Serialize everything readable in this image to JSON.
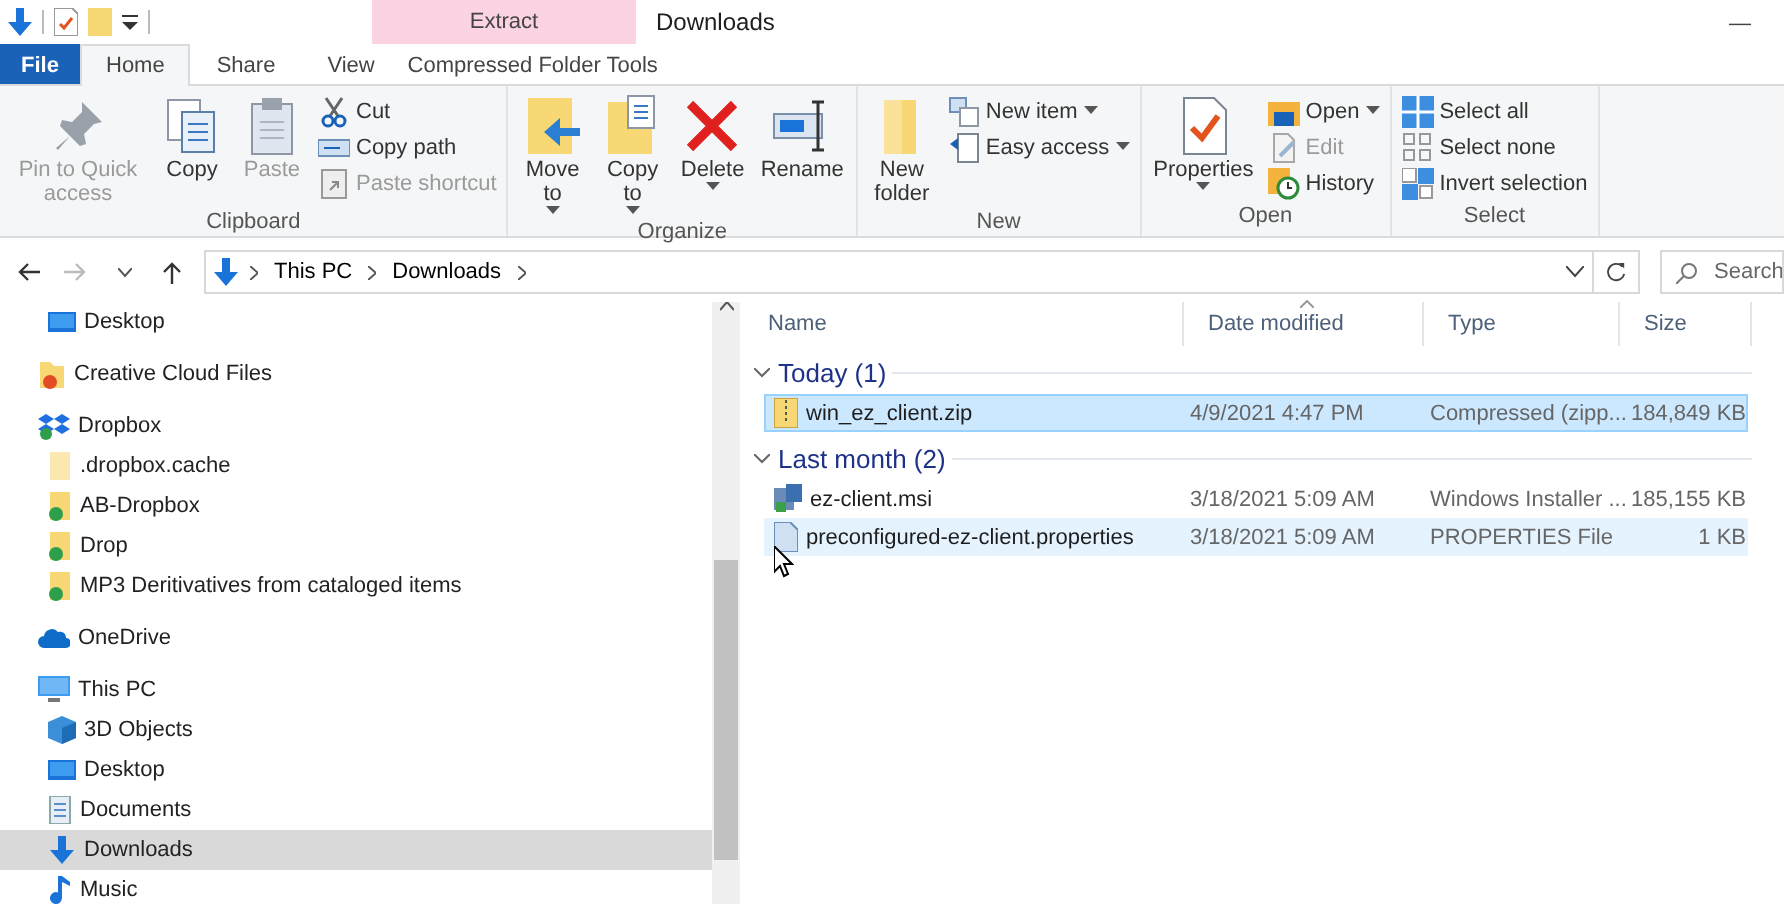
{
  "title_bar": {
    "context_tab": "Extract",
    "title": "Downloads",
    "minimize": "—"
  },
  "tabs": [
    {
      "label": "File",
      "kind": "file",
      "selected": false
    },
    {
      "label": "Home",
      "kind": "tab",
      "selected": true
    },
    {
      "label": "Share",
      "kind": "tab",
      "selected": false
    },
    {
      "label": "View",
      "kind": "tab",
      "selected": false
    },
    {
      "label": "Compressed Folder Tools",
      "kind": "context",
      "selected": false
    }
  ],
  "ribbon": {
    "groups": [
      {
        "label": "Clipboard",
        "buttons": [
          {
            "kind": "pin",
            "label": "Pin to Quick access",
            "disabled": true,
            "menu": false
          },
          {
            "kind": "copy",
            "label": "Copy",
            "disabled": false,
            "menu": false
          },
          {
            "kind": "paste",
            "label": "Paste",
            "disabled": true,
            "menu": false
          }
        ],
        "small_buttons": [
          {
            "kind": "cut",
            "label": "Cut",
            "disabled": false,
            "menu": false
          },
          {
            "kind": "copy-path",
            "label": "Copy path",
            "disabled": false,
            "menu": false
          },
          {
            "kind": "shortcut",
            "label": "Paste shortcut",
            "disabled": true,
            "menu": false
          }
        ]
      },
      {
        "label": "Organize",
        "buttons": [
          {
            "kind": "move",
            "label": "Move to",
            "disabled": false,
            "menu": true
          },
          {
            "kind": "copy-to",
            "label": "Copy to",
            "disabled": false,
            "menu": true
          },
          {
            "kind": "delete",
            "label": "Delete",
            "disabled": false,
            "menu": true
          },
          {
            "kind": "rename",
            "label": "Rename",
            "disabled": false,
            "menu": false
          }
        ]
      },
      {
        "label": "New",
        "buttons": [
          {
            "kind": "new-folder",
            "label": "New folder",
            "disabled": false,
            "menu": false
          }
        ],
        "small_buttons": [
          {
            "kind": "new-item",
            "label": "New item",
            "disabled": false,
            "menu": true
          },
          {
            "kind": "easy-access",
            "label": "Easy access",
            "disabled": false,
            "menu": true
          }
        ]
      },
      {
        "label": "Open",
        "buttons": [
          {
            "kind": "properties",
            "label": "Properties",
            "disabled": false,
            "menu": true
          }
        ],
        "small_buttons": [
          {
            "kind": "open",
            "label": "Open",
            "disabled": false,
            "menu": true
          },
          {
            "kind": "edit",
            "label": "Edit",
            "disabled": true,
            "menu": false
          },
          {
            "kind": "history",
            "label": "History",
            "disabled": false,
            "menu": false
          }
        ]
      },
      {
        "label": "Select",
        "small_buttons": [
          {
            "kind": "select-all",
            "label": "Select all",
            "disabled": false,
            "menu": false
          },
          {
            "kind": "select-none",
            "label": "Select none",
            "disabled": false,
            "menu": false
          },
          {
            "kind": "invert",
            "label": "Invert selection",
            "disabled": false,
            "menu": false
          }
        ]
      }
    ]
  },
  "address_bar": {
    "path": [
      "This PC",
      "Downloads"
    ],
    "search": {
      "placeholder": "Search"
    }
  },
  "navigation": {
    "items": [
      {
        "kind": "hidden",
        "children": [
          {
            "label": "Desktop",
            "kind": "desktop",
            "selected": false
          }
        ]
      },
      {
        "label": "Creative Cloud Files",
        "kind": "cc-folder",
        "selected": false
      },
      {
        "label": "Dropbox",
        "kind": "dropbox",
        "selected": false,
        "children": [
          {
            "label": ".dropbox.cache",
            "kind": "folder",
            "selected": false
          },
          {
            "label": "AB-Dropbox",
            "kind": "synced-folder",
            "selected": false
          },
          {
            "label": "Drop",
            "kind": "synced-folder",
            "selected": false
          },
          {
            "label": "MP3 Deritivatives from cataloged items",
            "kind": "synced-folder",
            "selected": false
          }
        ]
      },
      {
        "label": "OneDrive",
        "kind": "cloud",
        "selected": false
      },
      {
        "label": "This PC",
        "kind": "pc",
        "selected": false,
        "children": [
          {
            "label": "3D Objects",
            "kind": "cube",
            "selected": false
          },
          {
            "label": "Desktop",
            "kind": "desktop",
            "selected": false
          },
          {
            "label": "Documents",
            "kind": "documents",
            "selected": false
          },
          {
            "label": "Downloads",
            "kind": "downloads",
            "selected": true
          },
          {
            "label": "Music",
            "kind": "music",
            "selected": false
          }
        ]
      }
    ]
  },
  "file_list": {
    "columns": [
      "Name",
      "Date modified",
      "Type",
      "Size"
    ],
    "groups": [
      {
        "label": "Today (1)",
        "expanded": true,
        "rows": [
          {
            "kind": "zip",
            "name": "win_ez_client.zip",
            "date": "4/9/2021 4:47 PM",
            "type": "Compressed (zipp...",
            "size": "184,849 KB",
            "selected": true,
            "hovered": false
          }
        ]
      },
      {
        "label": "Last month (2)",
        "expanded": true,
        "rows": [
          {
            "kind": "msi",
            "name": "ez-client.msi",
            "date": "3/18/2021 5:09 AM",
            "type": "Windows Installer ...",
            "size": "185,155 KB",
            "selected": false,
            "hovered": false
          },
          {
            "kind": "properties",
            "name": "preconfigured-ez-client.properties",
            "date": "3/18/2021 5:09 AM",
            "type": "PROPERTIES File",
            "size": "1 KB",
            "selected": false,
            "hovered": true
          }
        ]
      }
    ]
  }
}
